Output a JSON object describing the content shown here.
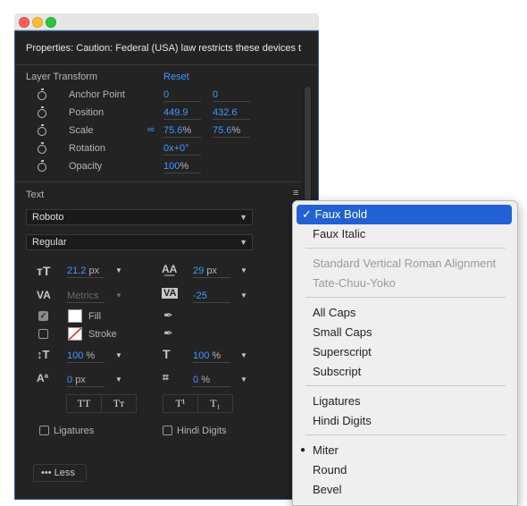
{
  "panel": {
    "title": "Properties: Caution: Federal (USA) law restricts these devices to"
  },
  "layer_transform": {
    "title": "Layer Transform",
    "reset": "Reset",
    "rows": [
      {
        "label": "Anchor Point",
        "v1": "0",
        "v2": "0"
      },
      {
        "label": "Position",
        "v1": "449.9",
        "v2": "432.6"
      },
      {
        "label": "Scale",
        "v1": "75.6",
        "v1_unit": "%",
        "v2": "75.6",
        "v2_unit": "%"
      },
      {
        "label": "Rotation",
        "v1": "0x+0°"
      },
      {
        "label": "Opacity",
        "v1": "100",
        "v1_unit": "%"
      }
    ]
  },
  "text": {
    "title": "Text",
    "font_family": "Roboto",
    "font_style": "Regular",
    "font_size": "21.2",
    "font_size_unit": "px",
    "leading": "29",
    "leading_unit": "px",
    "kerning": "Metrics",
    "tracking": "-25",
    "fill_label": "Fill",
    "stroke_label": "Stroke",
    "vert_scale": "100",
    "vert_scale_unit": "%",
    "horiz_scale": "100",
    "horiz_scale_unit": "%",
    "baseline": "0",
    "baseline_unit": "px",
    "tsume": "0",
    "tsume_unit": "%",
    "allcaps_glyph": "TT",
    "smallcaps_glyph": "Tт",
    "superscript_glyph": "T¹",
    "subscript_glyph": "T₁",
    "ligatures_label": "Ligatures",
    "hindi_digits_label": "Hindi Digits",
    "less_label": "••• Less"
  },
  "menu": {
    "checkmark": "✓",
    "bullet": "●",
    "items": [
      {
        "label": "Faux Bold"
      },
      {
        "label": "Faux Italic"
      },
      {
        "label": "Standard Vertical Roman Alignment"
      },
      {
        "label": "Tate-Chuu-Yoko"
      },
      {
        "label": "All Caps"
      },
      {
        "label": "Small Caps"
      },
      {
        "label": "Superscript"
      },
      {
        "label": "Subscript"
      },
      {
        "label": "Ligatures"
      },
      {
        "label": "Hindi Digits"
      },
      {
        "label": "Miter"
      },
      {
        "label": "Round"
      },
      {
        "label": "Bevel"
      }
    ]
  },
  "colors": {
    "accent": "#3d9bff",
    "highlight": "#2161d4",
    "panel_bg": "#232323"
  }
}
